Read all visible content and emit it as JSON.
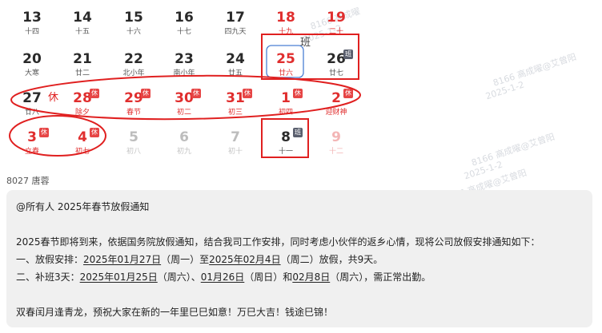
{
  "watermarks": [
    {
      "name": "8166 高成曜",
      "date": "2025-1-2"
    },
    {
      "name": "8166 高成曜@艾曾阳",
      "date": "2025-1-2"
    },
    {
      "name": "8166 高成曜@艾曾阳",
      "date": "2025-1-2"
    },
    {
      "name": "8166 高成曜@艾曾阳",
      "date": "2025-1-2"
    }
  ],
  "calendar": {
    "badge_rest": "休",
    "badge_work": "班",
    "annot_work": "班",
    "annot_rest": "休",
    "days": [
      {
        "num": "13",
        "lunar": "十四"
      },
      {
        "num": "14",
        "lunar": "十五"
      },
      {
        "num": "15",
        "lunar": "十六"
      },
      {
        "num": "16",
        "lunar": "十七"
      },
      {
        "num": "17",
        "lunar": "四九天"
      },
      {
        "num": "18",
        "lunar": "十九"
      },
      {
        "num": "19",
        "lunar": "二十"
      },
      {
        "num": "20",
        "lunar": "大寒"
      },
      {
        "num": "21",
        "lunar": "廿二"
      },
      {
        "num": "22",
        "lunar": "北小年"
      },
      {
        "num": "23",
        "lunar": "南小年"
      },
      {
        "num": "24",
        "lunar": "廿五"
      },
      {
        "num": "25",
        "lunar": "廿六"
      },
      {
        "num": "26",
        "lunar": "廿七"
      },
      {
        "num": "27",
        "lunar": "廿八"
      },
      {
        "num": "28",
        "lunar": "除夕"
      },
      {
        "num": "29",
        "lunar": "春节"
      },
      {
        "num": "30",
        "lunar": "初二"
      },
      {
        "num": "31",
        "lunar": "初三"
      },
      {
        "num": "1",
        "lunar": "初四"
      },
      {
        "num": "2",
        "lunar": "迎财神"
      },
      {
        "num": "3",
        "lunar": "立春"
      },
      {
        "num": "4",
        "lunar": "初七"
      },
      {
        "num": "5",
        "lunar": "初八"
      },
      {
        "num": "6",
        "lunar": "初九"
      },
      {
        "num": "7",
        "lunar": "初十"
      },
      {
        "num": "8",
        "lunar": "十一"
      },
      {
        "num": "9",
        "lunar": "十二"
      }
    ]
  },
  "sender": "8027 唐蓉",
  "message": {
    "line1": "@所有人 2025年春节放假通知",
    "line2": "2025春节即将到来，依据国务院放假通知，结合我司工作安排，同时考虑小伙伴的返乡心情，现将公司放假安排通知如下：",
    "l3_a": "一、放假安排：",
    "l3_b": "2025年01月27日",
    "l3_c": "（周一）至",
    "l3_d": "2025年02月4日",
    "l3_e": "（周二）放假，共9天。",
    "l4_a": "二、补班3天：",
    "l4_b": "2025年01月25日",
    "l4_c": "（周六）、",
    "l4_d": "01月26日",
    "l4_e": "（周日）和",
    "l4_f": "02月8日",
    "l4_g": "（周六），需正常出勤。",
    "line5": "双春闰月逢青龙，预祝大家在新的一年里巳巳如意！万巳大吉！钱途巳锦！"
  }
}
